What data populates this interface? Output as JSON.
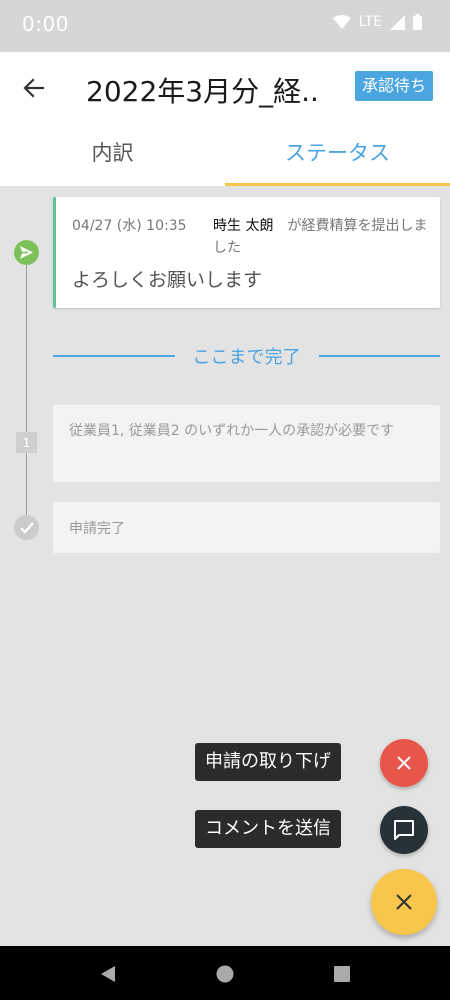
{
  "status_bar": {
    "time": "0:00",
    "network": "LTE",
    "icons": [
      "wifi-icon",
      "signal-icon",
      "battery-icon"
    ]
  },
  "app_bar": {
    "title": "2022年3月分_経..",
    "status_badge": "承認待ち",
    "back_icon": "arrow-left-icon"
  },
  "tabs": [
    {
      "label": "内訳",
      "active": false
    },
    {
      "label": "ステータス",
      "active": true
    }
  ],
  "timeline": {
    "submitted": {
      "timestamp": "04/27 (水) 10:35",
      "user": "時生 太朗",
      "action": "が経費精算を提出しました",
      "comment": "よろしくお願いします"
    },
    "divider_label": "ここまで完了",
    "pending_step": {
      "number": "1",
      "text": "従業員1, 従業員2 のいずれか一人の承認が必要です"
    },
    "complete_step": {
      "text": "申請完了"
    }
  },
  "fab_menu": {
    "withdraw_label": "申請の取り下げ",
    "comment_label": "コメントを送信"
  },
  "colors": {
    "accent": "#4aa5e0",
    "tab_indicator": "#f5c84a",
    "fab_main": "#f7c64b",
    "withdraw": "#e8554b",
    "comment_fab": "#263238",
    "submitted_icon": "#7cc05a"
  }
}
